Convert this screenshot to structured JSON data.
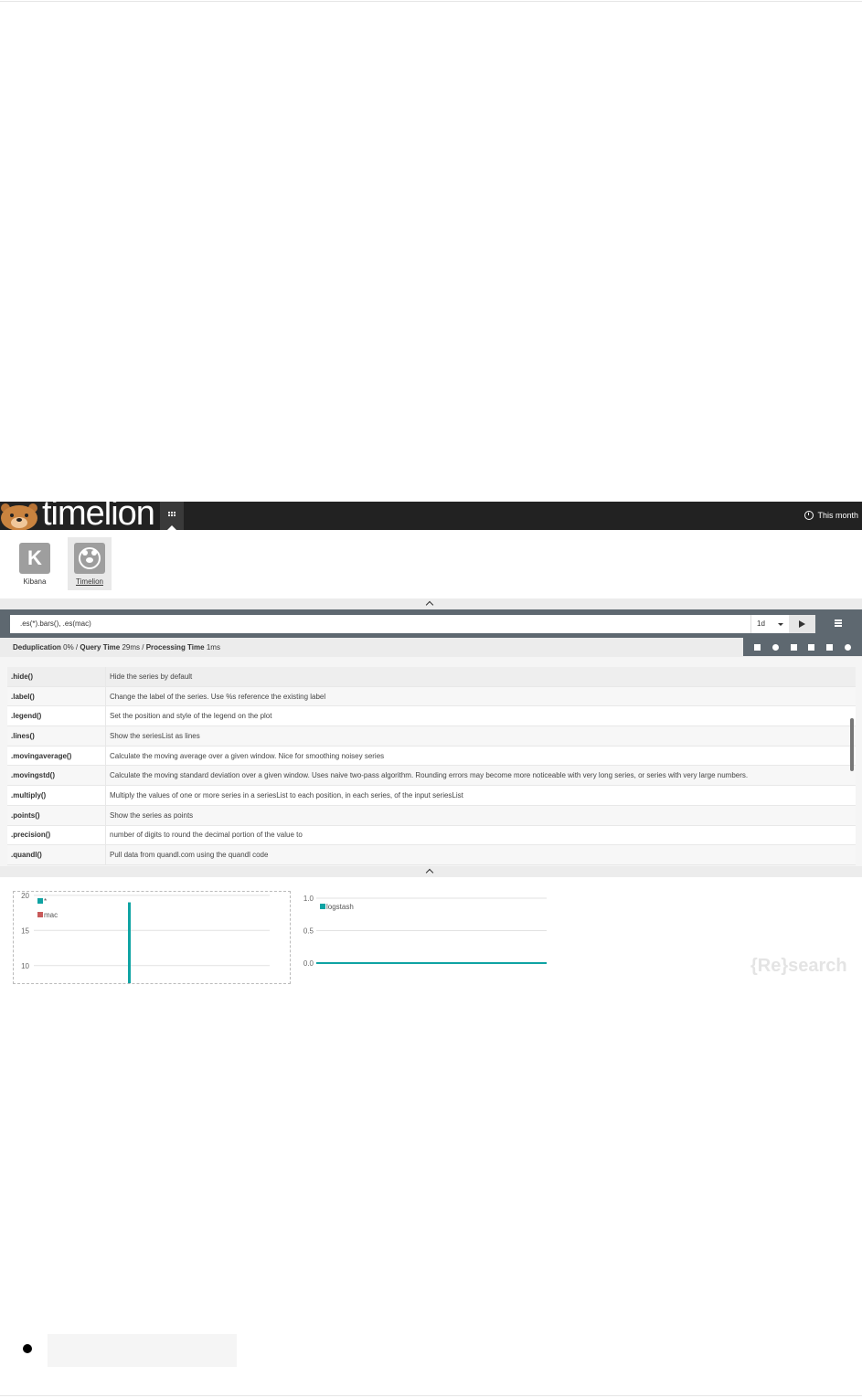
{
  "nav": {
    "brand": "timelion",
    "timepicker_label": "This month"
  },
  "app_drawer": {
    "apps": [
      {
        "label": "Kibana",
        "letter": "K"
      },
      {
        "label": "Timelion"
      }
    ]
  },
  "query": {
    "expression": ".es(*).bars(), .es(mac)",
    "interval": "1d"
  },
  "stats": {
    "dedup_label": "Deduplication",
    "dedup_value": "0%",
    "query_time_label": "Query Time",
    "query_time_value": "29ms",
    "processing_label": "Processing Time",
    "processing_value": "1ms"
  },
  "docs": {
    "rows": [
      {
        "fn": ".hide()",
        "desc": "Hide the series by default"
      },
      {
        "fn": ".label()",
        "desc": "Change the label of the series. Use %s reference the existing label"
      },
      {
        "fn": ".legend()",
        "desc": "Set the position and style of the legend on the plot"
      },
      {
        "fn": ".lines()",
        "desc": "Show the seriesList as lines"
      },
      {
        "fn": ".movingaverage()",
        "desc": "Calculate the moving average over a given window. Nice for smoothing noisey series"
      },
      {
        "fn": ".movingstd()",
        "desc": "Calculate the moving standard deviation over a given window. Uses naive two-pass algorithm. Rounding errors may become more noticeable with very long series, or series with very large numbers."
      },
      {
        "fn": ".multiply()",
        "desc": "Multiply the values of one or more series in a seriesList to each position, in each series, of the input seriesList"
      },
      {
        "fn": ".points()",
        "desc": "Show the series as points"
      },
      {
        "fn": ".precision()",
        "desc": "number of digits to round the decimal portion of the value to"
      },
      {
        "fn": ".quandl()",
        "desc": "Pull data from quandl.com using the quandl code"
      }
    ]
  },
  "chart_data": [
    {
      "type": "bar",
      "yticks": [
        10,
        15,
        20
      ],
      "ylim": [
        7.5,
        20.5
      ],
      "grid": true,
      "legend_position": "top-left",
      "series": [
        {
          "name": "*",
          "color": "#0fa3a3",
          "bars": [
            {
              "x_frac": 0.405,
              "value": 19
            }
          ]
        },
        {
          "name": "mac",
          "color": "#c85a5a",
          "bars": []
        }
      ]
    },
    {
      "type": "line",
      "yticks": [
        0.0,
        0.5,
        1.0
      ],
      "ylim": [
        0,
        1
      ],
      "grid": true,
      "legend_position": "top-left",
      "series": [
        {
          "name": "logstash",
          "color": "#0fa3a3",
          "values": [
            0,
            0
          ]
        }
      ]
    }
  ],
  "watermark": "{Re}search"
}
